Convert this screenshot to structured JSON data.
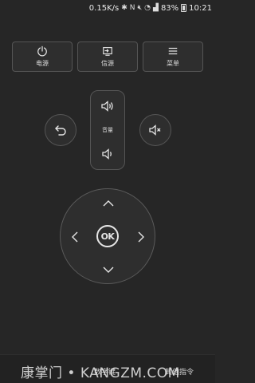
{
  "status_bar": {
    "network_speed": "0.15K/s",
    "battery_percent": "83%",
    "time": "10:21",
    "icons": [
      "bluetooth-icon",
      "nfc-icon",
      "mute-icon",
      "wifi-icon",
      "signal-icon",
      "battery-icon"
    ]
  },
  "top_buttons": [
    {
      "label": "电源",
      "icon": "power-icon"
    },
    {
      "label": "信源",
      "icon": "source-input-icon"
    },
    {
      "label": "菜单",
      "icon": "menu-icon"
    }
  ],
  "volume": {
    "label": "音量",
    "up_icon": "volume-up-icon",
    "down_icon": "volume-down-icon"
  },
  "side_buttons": {
    "back_icon": "back-icon",
    "mute_icon": "mute-icon"
  },
  "dpad": {
    "ok_label": "OK",
    "icons": [
      "arrow-up-icon",
      "arrow-down-icon",
      "arrow-left-icon",
      "arrow-right-icon"
    ]
  },
  "bottom_bar": {
    "numeric_keypad": "数字键",
    "other_commands": "其他指令",
    "watermark": "康掌门 • KANGZM.COM"
  },
  "colors": {
    "background": "#262626",
    "button_bg": "#2e2e2e",
    "border": "#555555",
    "text": "#e6e6e6"
  }
}
